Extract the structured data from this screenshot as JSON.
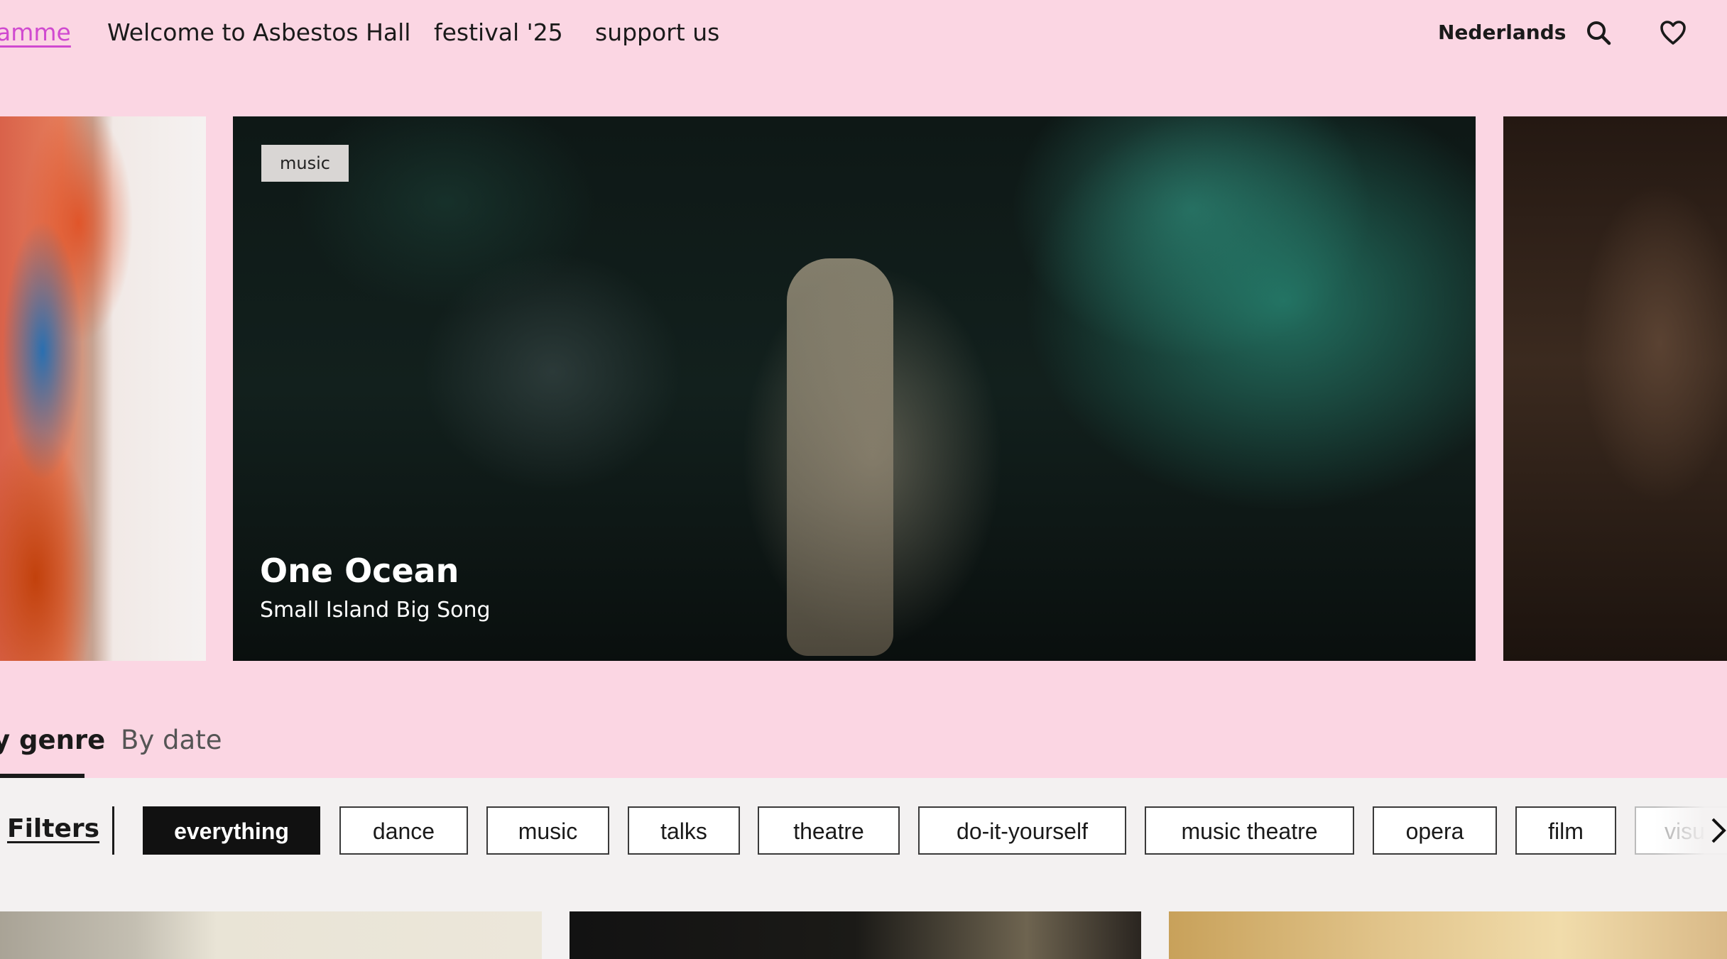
{
  "nav": {
    "links": [
      "amme",
      "Welcome to Asbestos Hall",
      "festival '25",
      "support us"
    ],
    "language": "Nederlands",
    "search_icon": "search-icon",
    "favorites_icon": "heart-icon",
    "accent_color": "#d04ad0"
  },
  "carousel": {
    "slide": {
      "tag": "music",
      "title": "One Ocean",
      "subtitle": "Small Island Big Song"
    }
  },
  "view_tabs": [
    "genre",
    "By date"
  ],
  "filters": {
    "label": "Filters",
    "chips": [
      "everything",
      "dance",
      "music",
      "talks",
      "theatre",
      "do-it-yourself",
      "music theatre",
      "opera",
      "film",
      "visu"
    ],
    "active": "everything",
    "next_icon": "chevron-right-icon"
  },
  "colors": {
    "background": "#fbd6e3",
    "filter_bar": "#f3f1f1",
    "active_chip": "#111111"
  }
}
